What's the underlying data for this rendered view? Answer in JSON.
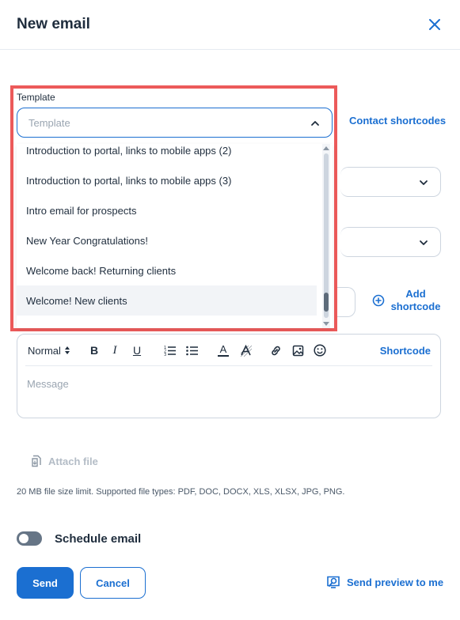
{
  "header": {
    "title": "New email"
  },
  "template": {
    "label": "Template",
    "placeholder": "Template",
    "options": [
      "Introduction to portal, links to mobile apps (2)",
      "Introduction to portal, links to mobile apps (3)",
      "Intro email for prospects",
      "New Year Congratulations!",
      "Welcome back! Returning clients",
      "Welcome! New clients"
    ],
    "hovered_option": "Welcome! New clients"
  },
  "contact_shortcodes_label": "Contact shortcodes",
  "add_shortcode_label": "Add shortcode",
  "editor": {
    "format_label": "Normal",
    "bold_label": "B",
    "italic_label": "I",
    "underline_label": "U",
    "text_color_label": "A",
    "shortcode_label": "Shortcode",
    "message_placeholder": "Message"
  },
  "attach_file_label": "Attach file",
  "size_note": "20 MB file size limit. Supported file types: PDF, DOC, DOCX, XLS, XLSX, JPG, PNG.",
  "schedule": {
    "label": "Schedule email",
    "enabled": false
  },
  "actions": {
    "send_label": "Send",
    "cancel_label": "Cancel",
    "preview_label": "Send preview to me"
  },
  "colors": {
    "accent": "#1b6fd1",
    "highlight_border": "#ec5a5a",
    "toggle_off": "#667586"
  },
  "icons": {
    "close": "close-icon",
    "chevron": "chevron-down-icon",
    "add": "plus-circle-icon",
    "attach": "attach-file-icon",
    "preview": "preview-icon"
  }
}
